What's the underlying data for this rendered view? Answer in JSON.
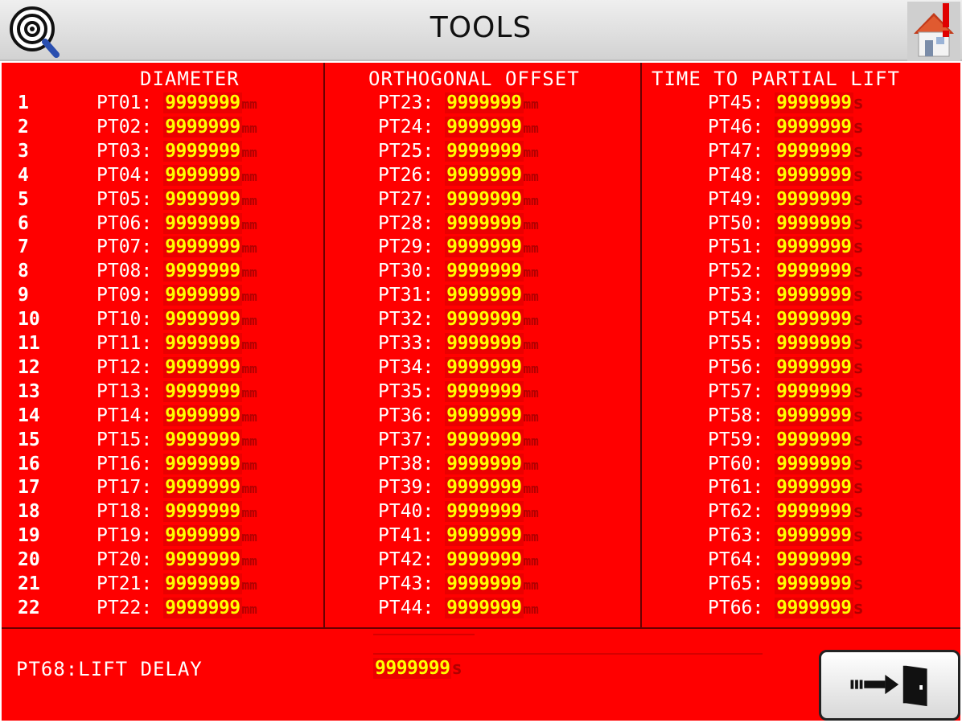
{
  "header": {
    "title": "TOOLS",
    "logo_icon": "radar-magnifier-icon",
    "home_icon": "home-alert-icon"
  },
  "columns": {
    "diameter": {
      "title": "DIAMETER"
    },
    "offset": {
      "title": "ORTHOGONAL OFFSET"
    },
    "lift": {
      "title": "TIME TO PARTIAL LIFT"
    }
  },
  "rows": [
    {
      "idx": "1",
      "d": "PT01:",
      "o": "PT23:",
      "l": "PT45:"
    },
    {
      "idx": "2",
      "d": "PT02:",
      "o": "PT24:",
      "l": "PT46:"
    },
    {
      "idx": "3",
      "d": "PT03:",
      "o": "PT25:",
      "l": "PT47:"
    },
    {
      "idx": "4",
      "d": "PT04:",
      "o": "PT26:",
      "l": "PT48:"
    },
    {
      "idx": "5",
      "d": "PT05:",
      "o": "PT27:",
      "l": "PT49:"
    },
    {
      "idx": "6",
      "d": "PT06:",
      "o": "PT28:",
      "l": "PT50:"
    },
    {
      "idx": "7",
      "d": "PT07:",
      "o": "PT29:",
      "l": "PT51:"
    },
    {
      "idx": "8",
      "d": "PT08:",
      "o": "PT30:",
      "l": "PT52:"
    },
    {
      "idx": "9",
      "d": "PT09:",
      "o": "PT31:",
      "l": "PT53:"
    },
    {
      "idx": "10",
      "d": "PT10:",
      "o": "PT32:",
      "l": "PT54:"
    },
    {
      "idx": "11",
      "d": "PT11:",
      "o": "PT33:",
      "l": "PT55:"
    },
    {
      "idx": "12",
      "d": "PT12:",
      "o": "PT34:",
      "l": "PT56:"
    },
    {
      "idx": "13",
      "d": "PT13:",
      "o": "PT35:",
      "l": "PT57:"
    },
    {
      "idx": "14",
      "d": "PT14:",
      "o": "PT36:",
      "l": "PT58:"
    },
    {
      "idx": "15",
      "d": "PT15:",
      "o": "PT37:",
      "l": "PT59:"
    },
    {
      "idx": "16",
      "d": "PT16:",
      "o": "PT38:",
      "l": "PT60:"
    },
    {
      "idx": "17",
      "d": "PT17:",
      "o": "PT39:",
      "l": "PT61:"
    },
    {
      "idx": "18",
      "d": "PT18:",
      "o": "PT40:",
      "l": "PT62:"
    },
    {
      "idx": "19",
      "d": "PT19:",
      "o": "PT41:",
      "l": "PT63:"
    },
    {
      "idx": "20",
      "d": "PT20:",
      "o": "PT42:",
      "l": "PT64:"
    },
    {
      "idx": "21",
      "d": "PT21:",
      "o": "PT43:",
      "l": "PT65:"
    },
    {
      "idx": "22",
      "d": "PT22:",
      "o": "PT44:",
      "l": "PT66:"
    }
  ],
  "value": "9999999",
  "units": {
    "mm": "mm",
    "s": "s"
  },
  "bottom": {
    "label": "PT68:LIFT DELAY",
    "value": "9999999",
    "unit": "s"
  },
  "exit_button": {
    "icon": "exit-door-icon"
  },
  "colors": {
    "panel": "#ff0000",
    "value_text": "#ffff00",
    "label_text": "#ffffff",
    "unit_text": "#b00000"
  }
}
